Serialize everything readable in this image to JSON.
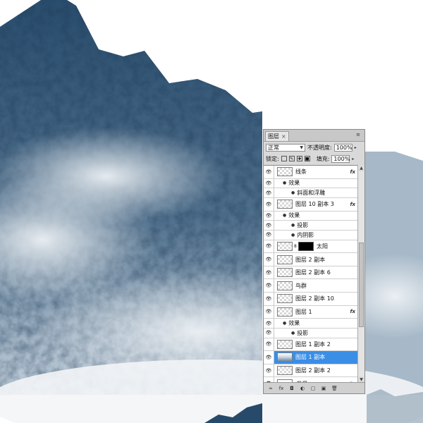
{
  "canvas": {
    "sky_color": "#ffffff",
    "mountain_dark": "#274a6a",
    "mountain_mid": "#5b7a96",
    "mist_color": "#e6ecf1"
  },
  "panel": {
    "tab_label": "图层",
    "tab_close": "×",
    "menu_icon": "≡",
    "blend_mode": "正常",
    "opacity_label": "不透明度:",
    "opacity_value": "100%",
    "lock_label": "锁定:",
    "fill_label": "填充:",
    "fill_value": "100%",
    "accent": "#3a8ee6"
  },
  "layers": [
    {
      "kind": "layer",
      "name": "线条",
      "fx": "fx",
      "thumb": "checker"
    },
    {
      "kind": "fx-header",
      "name": "效果"
    },
    {
      "kind": "fx-item",
      "name": "斜面和浮雕"
    },
    {
      "kind": "layer",
      "name": "图层 10 副本 3",
      "fx": "fx",
      "thumb": "checker"
    },
    {
      "kind": "fx-header",
      "name": "效果"
    },
    {
      "kind": "fx-item",
      "name": "投影"
    },
    {
      "kind": "fx-item",
      "name": "内阴影"
    },
    {
      "kind": "layer",
      "name": "太阳",
      "thumb": "checker",
      "mask": true
    },
    {
      "kind": "layer",
      "name": "图层 2 副本",
      "thumb": "checker"
    },
    {
      "kind": "layer",
      "name": "图层 2 副本 6",
      "thumb": "checker"
    },
    {
      "kind": "layer",
      "name": "鸟群",
      "thumb": "checker"
    },
    {
      "kind": "layer",
      "name": "图层 2 副本 10",
      "thumb": "checker"
    },
    {
      "kind": "layer",
      "name": "图层 1",
      "fx": "fx",
      "thumb": "checker"
    },
    {
      "kind": "fx-header",
      "name": "效果"
    },
    {
      "kind": "fx-item",
      "name": "投影"
    },
    {
      "kind": "layer",
      "name": "图层 1 副本 2",
      "thumb": "checker"
    },
    {
      "kind": "layer",
      "name": "图层 1 副本",
      "thumb": "mountain",
      "selected": true
    },
    {
      "kind": "layer",
      "name": "图层 2 副本 2",
      "thumb": "checker"
    },
    {
      "kind": "layer",
      "name": "背景",
      "thumb": "white",
      "locked": true,
      "italic": true
    }
  ],
  "footer_icons": [
    "∞",
    "fx",
    "◘",
    "◐",
    "▢",
    "▣",
    "🗑"
  ]
}
